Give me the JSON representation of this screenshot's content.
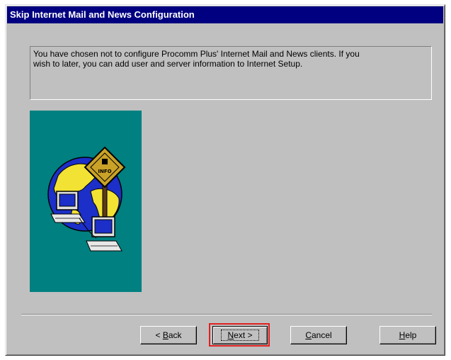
{
  "window": {
    "title": "Skip Internet Mail and News Configuration"
  },
  "message": {
    "line1": "You have chosen not to configure Procomm Plus' Internet Mail and News clients.  If you",
    "line2": "wish to later, you can add user and server information to Internet Setup."
  },
  "illustration": {
    "sign_text": "INFO",
    "icon": "globe-with-computers-icon"
  },
  "buttons": {
    "back": {
      "prefix": "< ",
      "mnemonic": "B",
      "rest": "ack"
    },
    "next": {
      "mnemonic": "N",
      "rest": "ext >"
    },
    "cancel": {
      "mnemonic": "C",
      "rest": "ancel"
    },
    "help": {
      "mnemonic": "H",
      "rest": "elp"
    }
  },
  "colors": {
    "titlebar": "#000080",
    "face": "#c0c0c0",
    "picture_bg": "#008080",
    "highlight": "#e02020"
  }
}
